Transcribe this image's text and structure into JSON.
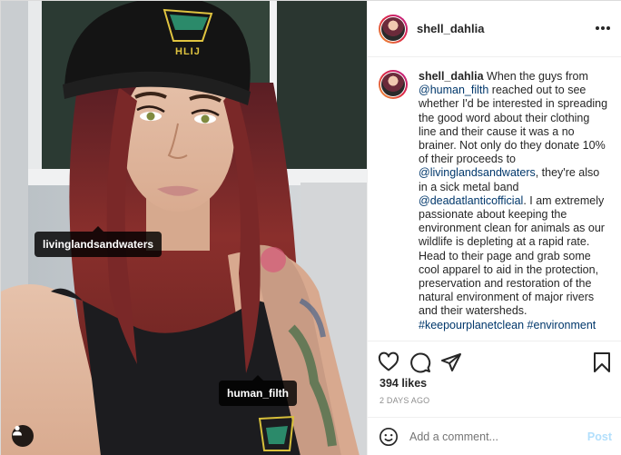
{
  "photo": {
    "tags": [
      "livinglandsandwaters",
      "human_filth"
    ],
    "beanie_text": "HLIJ"
  },
  "post": {
    "username": "shell_dahlia",
    "caption": {
      "username": "shell_dahlia",
      "seg1": " When the guys from ",
      "mention1": "@human_filth",
      "seg2": " reached out to see whether I'd be interested in spreading the good word about their clothing line and their cause it was a no brainer. Not only do they donate 10% of their proceeds to ",
      "mention2": "@livinglandsandwaters",
      "seg3": ", they're also in a sick metal band ",
      "mention3": "@deadatlanticofficial",
      "seg4": ". I am extremely passionate about keeping the environment clean for animals as our wildlife is depleting at a rapid rate. Head to their page and grab some cool apparel to aid in the protection, preservation and restoration of the natural environment of major rivers and their watersheds.",
      "hashtags": "#keepourplanetclean #environment"
    },
    "likes": "394 likes",
    "time_ago": "2 DAYS AGO",
    "comment_placeholder": "Add a comment...",
    "post_label": "Post"
  },
  "icons": {
    "more": "more-dots-icon",
    "like": "heart-icon",
    "comment": "comment-icon",
    "share": "paper-plane-icon",
    "save": "bookmark-icon",
    "emoji": "smiley-icon",
    "user_tags": "person-icon"
  },
  "colors": {
    "link": "#00376b",
    "post_disabled": "#b2dffc",
    "muted": "#8e8e8e"
  }
}
